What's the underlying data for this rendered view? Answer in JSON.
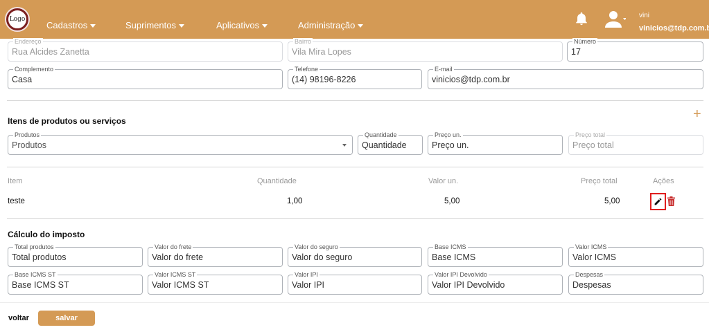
{
  "header": {
    "logo_text": "Logo",
    "nav": [
      "Cadastros",
      "Suprimentos",
      "Aplicativos",
      "Administração"
    ],
    "user_name": "vini",
    "user_email": "vinicios@tdp.com.br"
  },
  "address": {
    "endereco": {
      "label": "Endereço",
      "value": "Rua Alcides Zanetta"
    },
    "bairro": {
      "label": "Bairro",
      "value": "Vila Mira Lopes"
    },
    "numero": {
      "label": "Número",
      "value": "17"
    },
    "complemento": {
      "label": "Complemento",
      "value": "Casa"
    },
    "telefone": {
      "label": "Telefone",
      "value": "(14) 98196-8226"
    },
    "email": {
      "label": "E-mail",
      "value": "vinicios@tdp.com.br"
    }
  },
  "items_section": {
    "title": "Itens de produtos ou serviços",
    "add_icon": "plus-icon",
    "produtos": {
      "label": "Produtos",
      "value": "Produtos"
    },
    "quantidade": {
      "label": "Quantidade",
      "value": "Quantidade"
    },
    "preco_un": {
      "label": "Preço un.",
      "value": "Preço un."
    },
    "preco_total": {
      "label": "Preço total",
      "value": "Preço total"
    }
  },
  "table": {
    "headers": [
      "Item",
      "Quantidade",
      "Valor un.",
      "Preço total",
      "Ações"
    ],
    "rows": [
      {
        "item": "teste",
        "quantidade": "1,00",
        "valor_un": "5,00",
        "preco_total": "5,00"
      }
    ]
  },
  "tax_section": {
    "title": "Cálculo do imposto",
    "row1": [
      {
        "label": "Total produtos",
        "value": "Total produtos"
      },
      {
        "label": "Valor do frete",
        "value": "Valor do frete"
      },
      {
        "label": "Valor do seguro",
        "value": "Valor do seguro"
      },
      {
        "label": "Base ICMS",
        "value": "Base ICMS"
      },
      {
        "label": "Valor ICMS",
        "value": "Valor ICMS"
      }
    ],
    "row2": [
      {
        "label": "Base ICMS ST",
        "value": "Base ICMS ST"
      },
      {
        "label": "Valor ICMS ST",
        "value": "Valor ICMS ST"
      },
      {
        "label": "Valor IPI",
        "value": "Valor IPI"
      },
      {
        "label": "Valor IPI Devolvido",
        "value": "Valor IPI Devolvido"
      },
      {
        "label": "Despesas",
        "value": "Despesas"
      }
    ]
  },
  "footer": {
    "voltar": "voltar",
    "salvar": "salvar"
  },
  "colors": {
    "brand": "#d49a55",
    "danger": "#c62828",
    "highlight": "#e01e1e"
  }
}
